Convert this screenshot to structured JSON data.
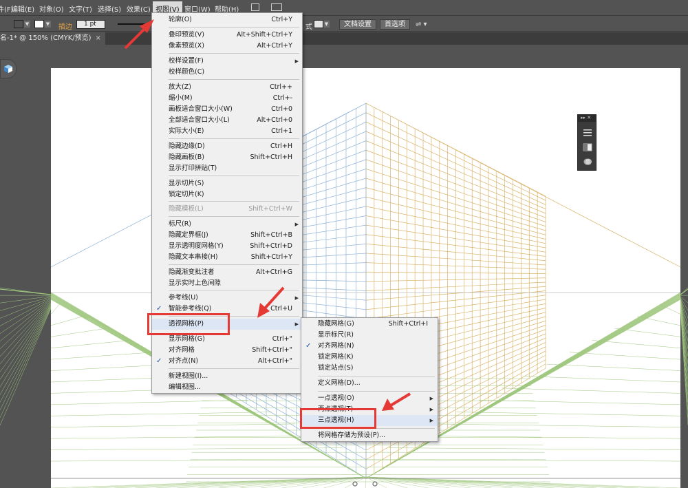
{
  "menubar": {
    "items": [
      {
        "label": "件(F)"
      },
      {
        "label": "编辑(E)"
      },
      {
        "label": "对象(O)"
      },
      {
        "label": "文字(T)"
      },
      {
        "label": "选择(S)"
      },
      {
        "label": "效果(C)"
      },
      {
        "label": "视图(V)"
      },
      {
        "label": "窗口(W)"
      },
      {
        "label": "帮助(H)"
      }
    ]
  },
  "control_bar": {
    "fill_color": "#d2515b",
    "stroke_label": "描边",
    "stroke_weight": "1 pt",
    "style_label": "式",
    "doc_setup_button": "文档设置",
    "preferences_button": "首选项",
    "arrange_icon": "arrange-icon"
  },
  "document_tab": {
    "title": "名-1* @ 150% (CMYK/预览)",
    "close": "×"
  },
  "view_menu": {
    "items": [
      {
        "label": "轮廓(O)",
        "shortcut": "Ctrl+Y"
      },
      {
        "label": "叠印预览(V)",
        "shortcut": "Alt+Shift+Ctrl+Y"
      },
      {
        "label": "像素预览(X)",
        "shortcut": "Alt+Ctrl+Y"
      },
      {
        "label": "校样设置(F)",
        "shortcut": "",
        "submenu": true
      },
      {
        "label": "校样颜色(C)",
        "shortcut": ""
      },
      {
        "label": "放大(Z)",
        "shortcut": "Ctrl++"
      },
      {
        "label": "缩小(M)",
        "shortcut": "Ctrl+-"
      },
      {
        "label": "画板适合窗口大小(W)",
        "shortcut": "Ctrl+0"
      },
      {
        "label": "全部适合窗口大小(L)",
        "shortcut": "Alt+Ctrl+0"
      },
      {
        "label": "实际大小(E)",
        "shortcut": "Ctrl+1"
      },
      {
        "label": "隐藏边缘(D)",
        "shortcut": "Ctrl+H"
      },
      {
        "label": "隐藏画板(B)",
        "shortcut": "Shift+Ctrl+H"
      },
      {
        "label": "显示打印拼贴(T)",
        "shortcut": ""
      },
      {
        "label": "显示切片(S)",
        "shortcut": ""
      },
      {
        "label": "锁定切片(K)",
        "shortcut": ""
      },
      {
        "label": "隐藏模板(L)",
        "shortcut": "Shift+Ctrl+W",
        "disabled": true
      },
      {
        "label": "标尺(R)",
        "shortcut": "",
        "submenu": true
      },
      {
        "label": "隐藏定界框(J)",
        "shortcut": "Shift+Ctrl+B"
      },
      {
        "label": "显示透明度网格(Y)",
        "shortcut": "Shift+Ctrl+D"
      },
      {
        "label": "隐藏文本串接(H)",
        "shortcut": "Shift+Ctrl+Y"
      },
      {
        "label": "隐藏渐变批注者",
        "shortcut": "Alt+Ctrl+G"
      },
      {
        "label": "显示实时上色间隙",
        "shortcut": ""
      },
      {
        "label": "参考线(U)",
        "shortcut": "",
        "submenu": true
      },
      {
        "label": "智能参考线(Q)",
        "shortcut": "Ctrl+U",
        "checked": true
      },
      {
        "label": "透视网格(P)",
        "shortcut": "",
        "submenu": true,
        "highlighted": true
      },
      {
        "label": "显示网格(G)",
        "shortcut": "Ctrl+\""
      },
      {
        "label": "对齐网格",
        "shortcut": "Shift+Ctrl+\""
      },
      {
        "label": "对齐点(N)",
        "shortcut": "Alt+Ctrl+\"",
        "checked": true
      },
      {
        "label": "新建视图(I)...",
        "shortcut": ""
      },
      {
        "label": "编辑视图...",
        "shortcut": ""
      }
    ]
  },
  "perspective_menu": {
    "items": [
      {
        "label": "隐藏网格(G)",
        "shortcut": "Shift+Ctrl+I"
      },
      {
        "label": "显示标尺(R)",
        "shortcut": ""
      },
      {
        "label": "对齐网格(N)",
        "shortcut": "",
        "checked": true
      },
      {
        "label": "锁定网格(K)",
        "shortcut": ""
      },
      {
        "label": "锁定站点(S)",
        "shortcut": ""
      },
      {
        "label": "定义网格(D)...",
        "shortcut": ""
      },
      {
        "label": "一点透视(O)",
        "shortcut": "",
        "submenu": true
      },
      {
        "label": "两点透视(T)",
        "shortcut": "",
        "submenu": true
      },
      {
        "label": "三点透视(H)",
        "shortcut": "",
        "submenu": true,
        "highlighted": true
      },
      {
        "label": "将网格存储为预设(P)...",
        "shortcut": ""
      }
    ]
  },
  "colors": {
    "annotation_red": "#e53935",
    "grid_orange": "#d9b46a",
    "grid_blue": "#8fb1d6",
    "grid_green": "#9fc77e"
  }
}
